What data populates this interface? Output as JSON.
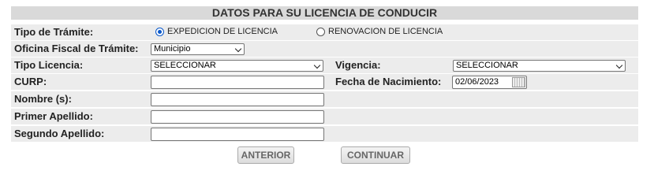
{
  "form": {
    "title": "DATOS PARA SU LICENCIA DE CONDUCIR",
    "tipo_tramite": {
      "label": "Tipo de Trámite:",
      "options": [
        {
          "label": "EXPEDICION DE LICENCIA",
          "selected": true
        },
        {
          "label": "RENOVACION DE LICENCIA",
          "selected": false
        }
      ]
    },
    "oficina": {
      "label": "Oficina Fiscal de Trámite:",
      "value": "Municipio"
    },
    "tipo_licencia": {
      "label": "Tipo Licencia:",
      "value": "SELECCIONAR"
    },
    "vigencia": {
      "label": "Vigencia:",
      "value": "SELECCIONAR"
    },
    "curp": {
      "label": "CURP:",
      "value": ""
    },
    "fecha_nacimiento": {
      "label": "Fecha de Nacimiento:",
      "value": "02/06/2023"
    },
    "nombre": {
      "label": "Nombre (s):",
      "value": ""
    },
    "primer_apellido": {
      "label": "Primer Apellido:",
      "value": ""
    },
    "segundo_apellido": {
      "label": "Segundo Apellido:",
      "value": ""
    }
  },
  "buttons": {
    "anterior": "ANTERIOR",
    "continuar": "CONTINUAR"
  },
  "colors": {
    "header_bg": "#d9d9d9",
    "row_alt_bg": "#ececec",
    "radio_accent": "#0a58ca"
  },
  "icons": {
    "calendar": "calendar-icon",
    "dropdown": "chevron-down-icon"
  }
}
